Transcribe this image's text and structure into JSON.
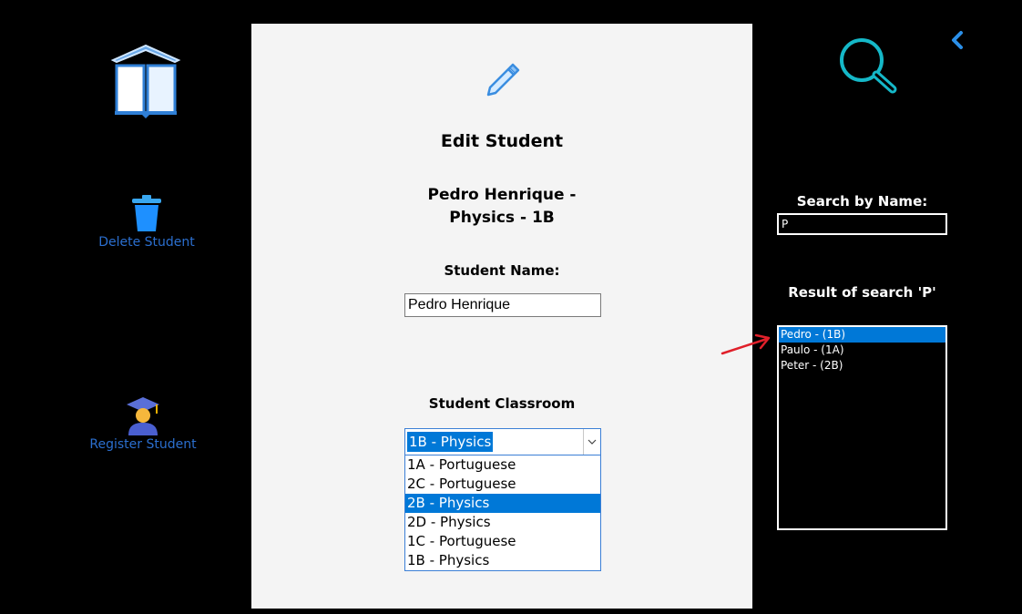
{
  "sidebar": {
    "items": [
      {
        "label": "Delete Student",
        "icon": "trash-icon"
      },
      {
        "label": "Register Student",
        "icon": "graduate-icon"
      }
    ]
  },
  "header": {
    "back_icon": "chevron-left-icon",
    "search_icon": "magnifier-icon"
  },
  "main": {
    "title": "Edit Student",
    "subtitle_line1": "Pedro Henrique -",
    "subtitle_line2": "Physics - 1B",
    "name_label": "Student Name:",
    "name_value": "Pedro Henrique",
    "classroom_label": "Student Classroom",
    "classroom_selected": "1B - Physics",
    "classroom_options": [
      "1A - Portuguese",
      "2C - Portuguese",
      "2B - Physics",
      "2D - Physics",
      "1C - Portuguese",
      "1B - Physics"
    ],
    "highlighted_option": "2B - Physics"
  },
  "search": {
    "label": "Search by Name:",
    "value": "P",
    "results_label": "Result of search 'P'",
    "results": [
      "Pedro - (1B)",
      "Paulo - (1A)",
      "Peter - (2B)"
    ],
    "selected_result": "Pedro - (1B)"
  },
  "colors": {
    "accent": "#0078d7",
    "link": "#2b6fcf",
    "search_icon": "#15b8c8",
    "arrow_annotation": "#e0202a"
  }
}
